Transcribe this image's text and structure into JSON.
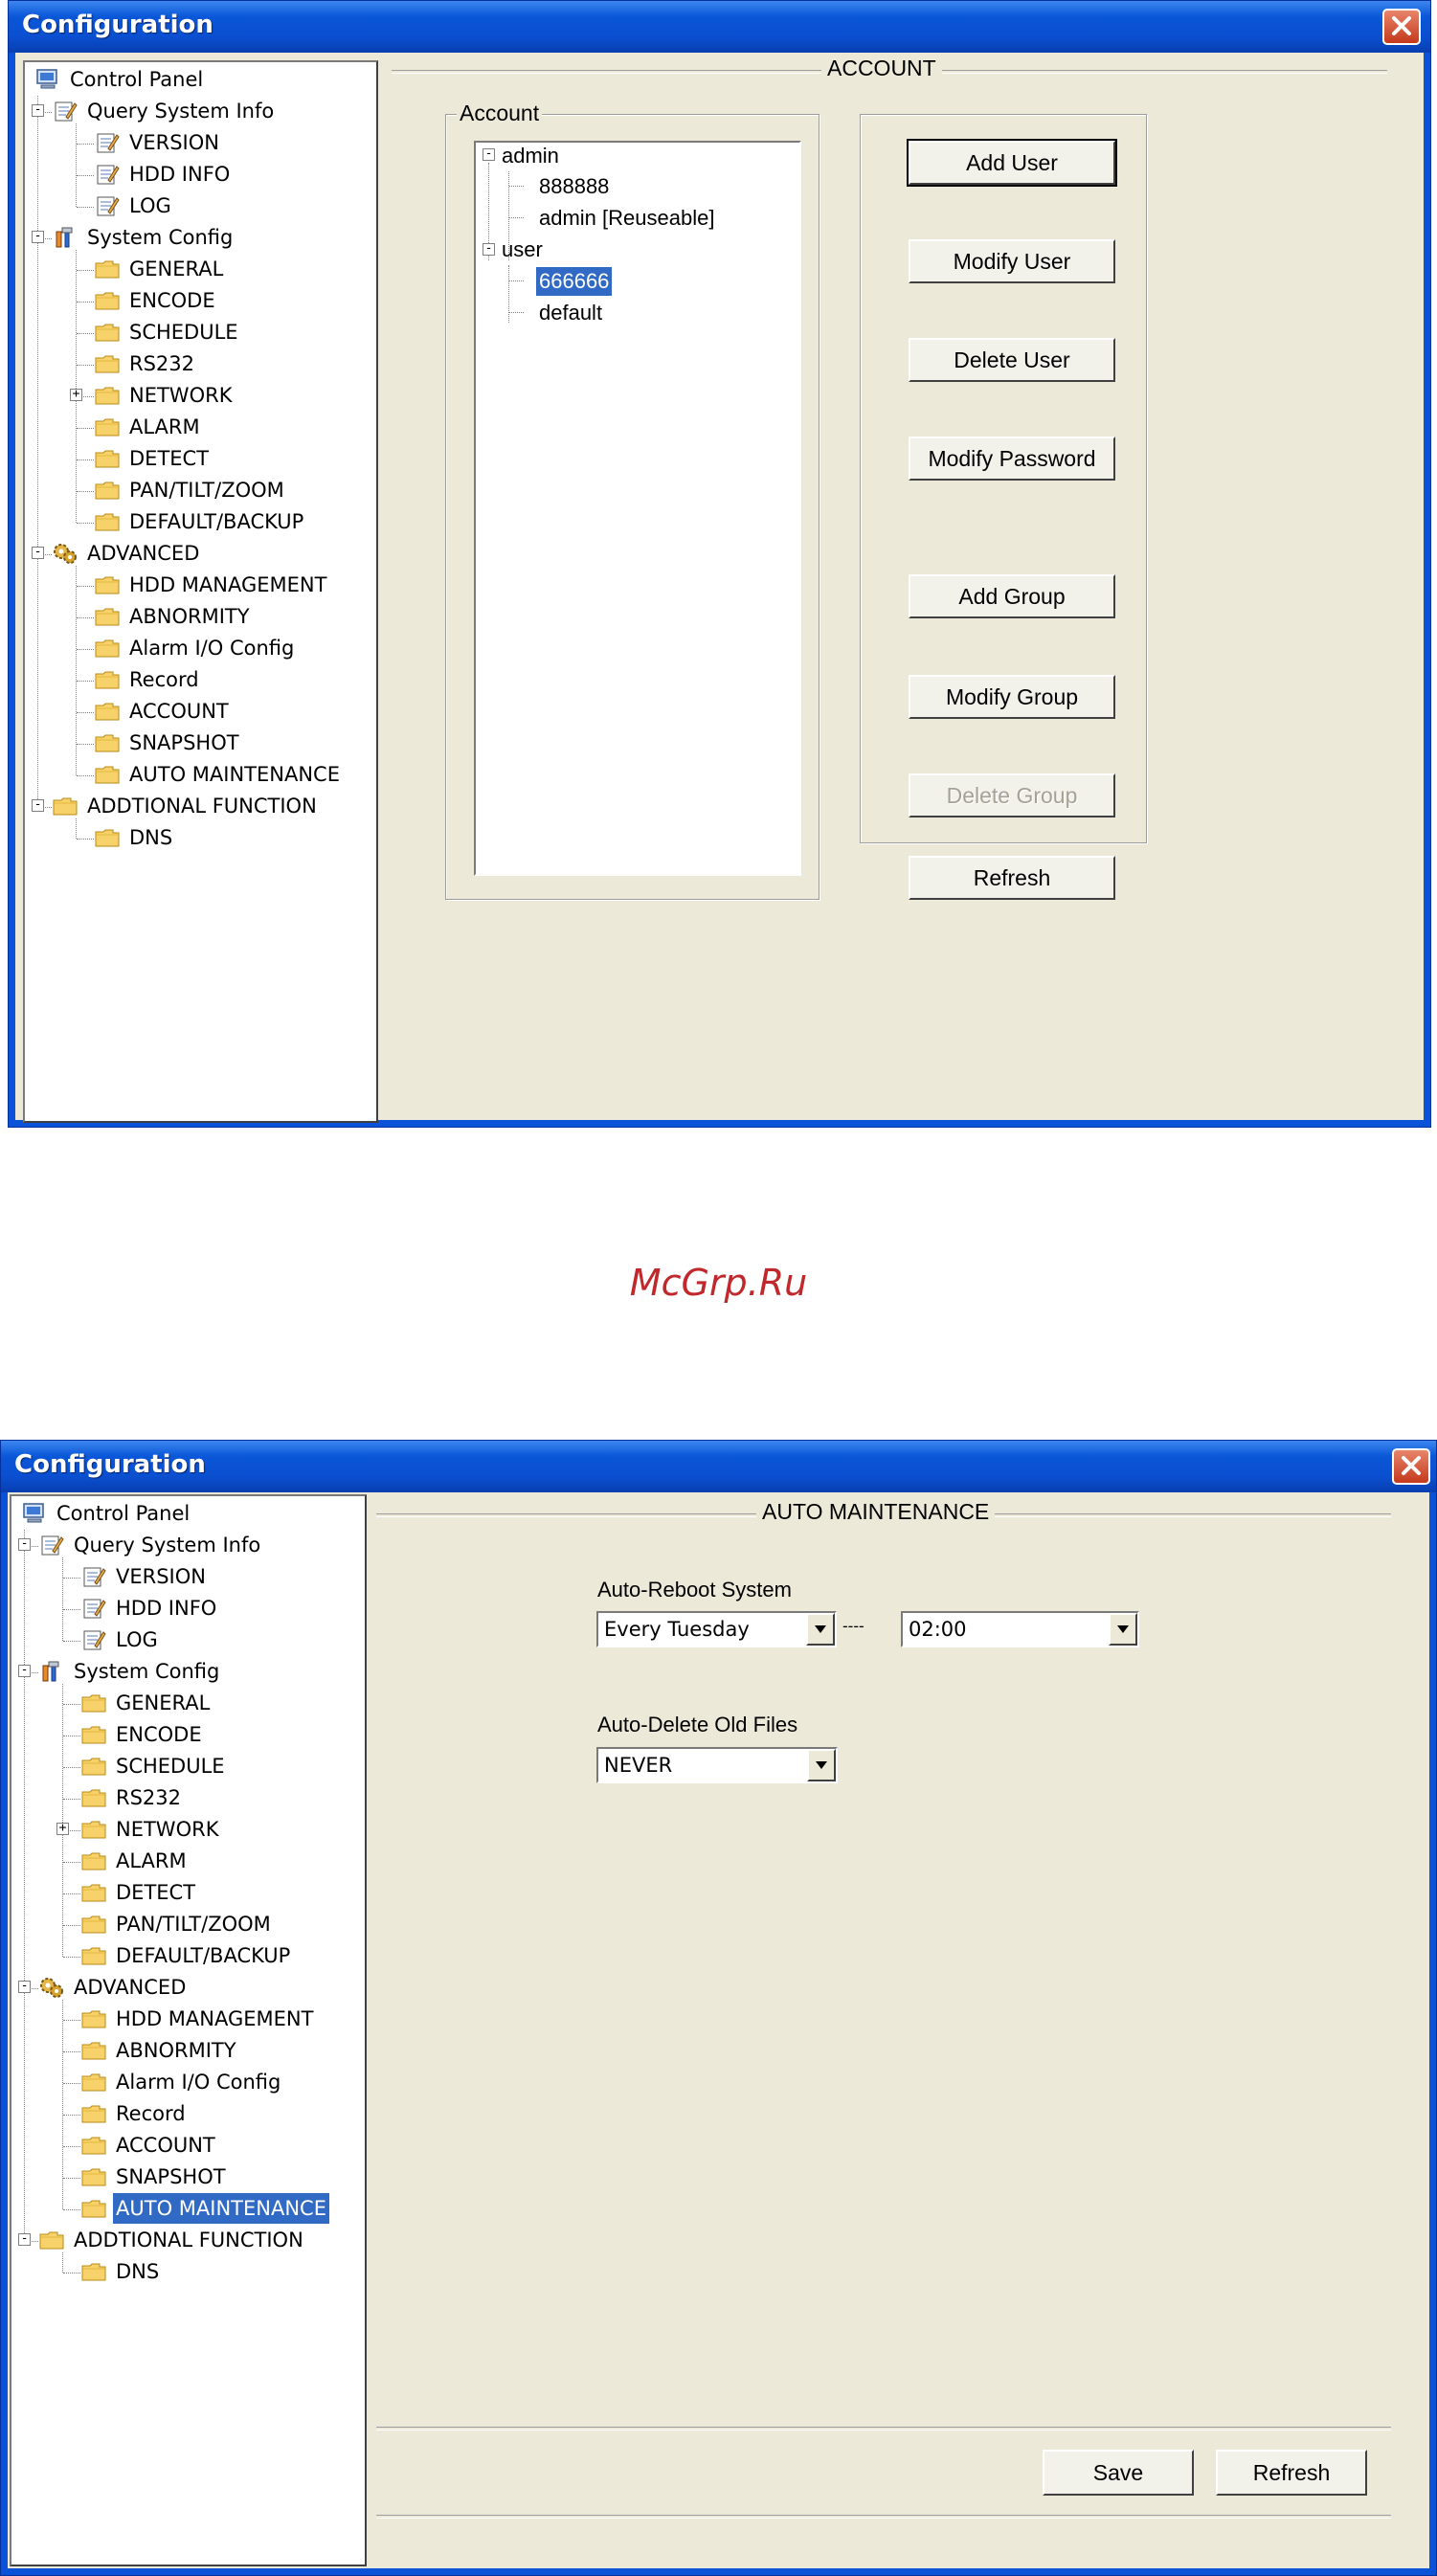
{
  "window_title": "Configuration",
  "watermark": "McGrp.Ru",
  "tree_items": [
    {
      "label": "Control Panel",
      "icon": "computer-icon"
    },
    {
      "label": "Query System Info",
      "icon": "notepad-icon"
    },
    {
      "label": "VERSION",
      "icon": "notepad-icon"
    },
    {
      "label": "HDD INFO",
      "icon": "notepad-icon"
    },
    {
      "label": "LOG",
      "icon": "notepad-icon"
    },
    {
      "label": "System Config",
      "icon": "tools-icon"
    },
    {
      "label": "GENERAL",
      "icon": "folder-icon"
    },
    {
      "label": "ENCODE",
      "icon": "folder-icon"
    },
    {
      "label": "SCHEDULE",
      "icon": "folder-icon"
    },
    {
      "label": "RS232",
      "icon": "folder-icon"
    },
    {
      "label": "NETWORK",
      "icon": "folder-icon"
    },
    {
      "label": "ALARM",
      "icon": "folder-icon"
    },
    {
      "label": "DETECT",
      "icon": "folder-icon"
    },
    {
      "label": "PAN/TILT/ZOOM",
      "icon": "folder-icon"
    },
    {
      "label": "DEFAULT/BACKUP",
      "icon": "folder-icon"
    },
    {
      "label": "ADVANCED",
      "icon": "gears-icon"
    },
    {
      "label": "HDD MANAGEMENT",
      "icon": "folder-icon"
    },
    {
      "label": "ABNORMITY",
      "icon": "folder-icon"
    },
    {
      "label": "Alarm I/O Config",
      "icon": "folder-icon"
    },
    {
      "label": "Record",
      "icon": "folder-icon"
    },
    {
      "label": "ACCOUNT",
      "icon": "folder-icon"
    },
    {
      "label": "SNAPSHOT",
      "icon": "folder-icon"
    },
    {
      "label": "AUTO MAINTENANCE",
      "icon": "folder-icon"
    },
    {
      "label": "ADDTIONAL FUNCTION",
      "icon": "folder-icon"
    },
    {
      "label": "DNS",
      "icon": "folder-icon"
    }
  ],
  "account_window": {
    "section_title": "ACCOUNT",
    "group_title": "Account",
    "account_tree": [
      "admin",
      "888888",
      "admin [Reuseable]",
      "user",
      "666666",
      "default"
    ],
    "selected_account": "666666",
    "buttons": {
      "add_user": "Add User",
      "modify_user": "Modify User",
      "delete_user": "Delete User",
      "modify_password": "Modify Password",
      "add_group": "Add Group",
      "modify_group": "Modify Group",
      "delete_group": "Delete Group",
      "refresh": "Refresh"
    }
  },
  "maintenance_window": {
    "section_title": "AUTO MAINTENANCE",
    "reboot_label": "Auto-Reboot System",
    "reboot_day": "Every Tuesday",
    "separator": "----",
    "reboot_time": "02:00",
    "delete_label": "Auto-Delete Old Files",
    "delete_value": "NEVER",
    "buttons": {
      "save": "Save",
      "refresh": "Refresh"
    }
  }
}
